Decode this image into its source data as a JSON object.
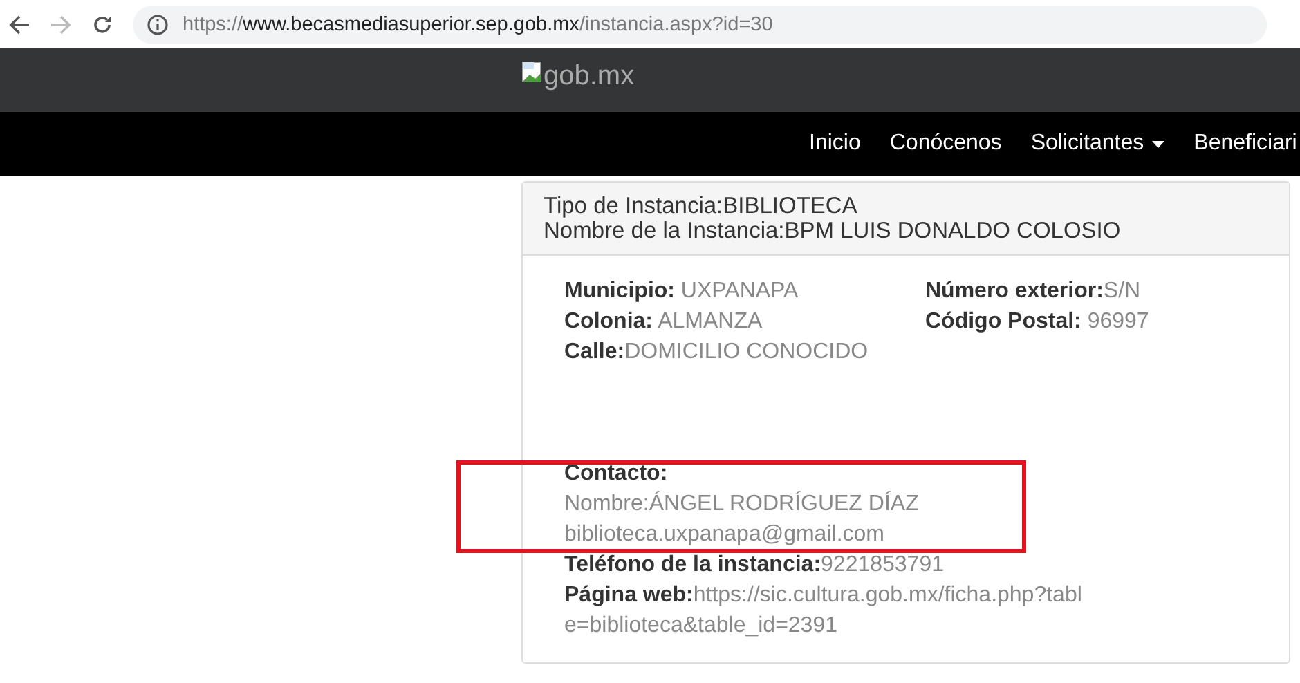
{
  "browser": {
    "url_scheme": "https://",
    "url_host": "www.becasmediasuperior.sep.gob.mx",
    "url_path": "/instancia.aspx?id=30",
    "back_disabled": false,
    "forward_disabled": true
  },
  "header": {
    "logo_alt": "gob.mx"
  },
  "nav": [
    {
      "label": "Inicio",
      "dropdown": false
    },
    {
      "label": "Conócenos",
      "dropdown": false
    },
    {
      "label": "Solicitantes",
      "dropdown": true
    },
    {
      "label": "Beneficiari",
      "dropdown": false
    }
  ],
  "card": {
    "header_lines": [
      "Tipo de Instancia:BIBLIOTECA",
      "Nombre de la Instancia:BPM LUIS DONALDO COLOSIO"
    ],
    "column_1": [
      "**Municipio:** UXPANAPA",
      "**Colonia:** ALMANZA",
      "**Calle:**DOMICILIO CONOCIDO"
    ],
    "column_2": [
      "**Número exterior:**S/N",
      "**Código Postal:** 96997"
    ],
    "contact": {
      "heading": "Contacto:",
      "lines": [
        "Nombre:ÁNGEL RODRÍGUEZ DÍAZ",
        "biblioteca.uxpanapa@gmail.com"
      ],
      "highlighted": true
    },
    "phone": "**Teléfono de la instancia:**9221853791",
    "web": "**Página web:**https://sic.cultura.gob.mx/ficha.php?table=biblioteca&table_id=2391"
  }
}
